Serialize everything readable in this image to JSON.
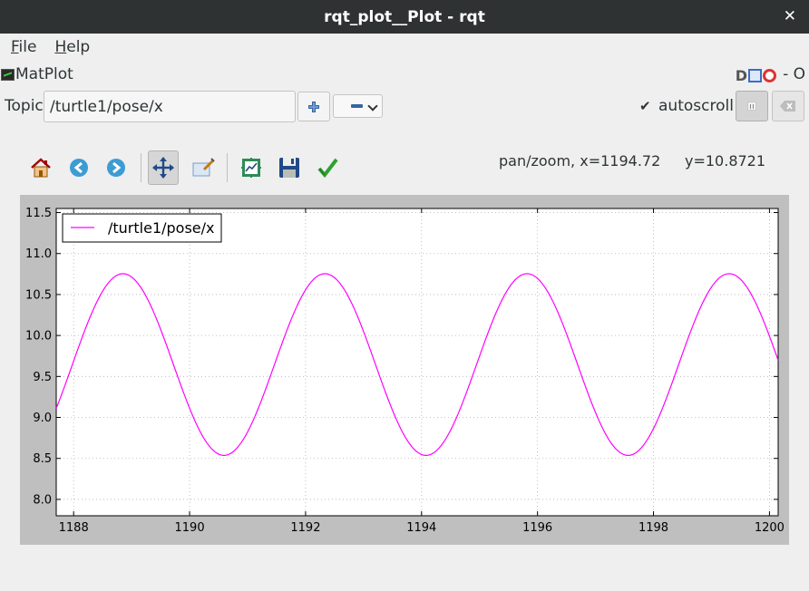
{
  "window": {
    "title": "rqt_plot__Plot - rqt",
    "close_glyph": "✕"
  },
  "menu": [
    {
      "mnemonic": "F",
      "rest": "ile"
    },
    {
      "mnemonic": "H",
      "rest": "elp"
    }
  ],
  "plugin": {
    "title": "MatPlot",
    "dock_label": "D",
    "suffix": "- O"
  },
  "topic": {
    "label": "Topic",
    "value": "/turtle1/pose/x",
    "add_icon": "plus-icon",
    "remove_icon": "minus-icon"
  },
  "autoscroll": {
    "label": "autoscroll",
    "checked": true
  },
  "toolbar": {
    "tools": [
      "home-icon",
      "back-icon",
      "forward-icon",
      "pan-zoom-icon",
      "configure-subplots-icon",
      "edit-axis-icon",
      "save-icon",
      "apply-icon"
    ],
    "active_tool": "pan-zoom-icon",
    "status": "pan/zoom, x=1194.72",
    "status_y": "y=10.8721"
  },
  "colors": {
    "line": "#ff00ff",
    "titlebar": "#2f3233",
    "plot_bg": "#ffffff",
    "frame": "#bfbfbf"
  },
  "chart_data": {
    "type": "line",
    "series": [
      {
        "name": "/turtle1/pose/x",
        "color": "#ff00ff"
      }
    ],
    "xlim": [
      1187.7,
      1200.15
    ],
    "ylim": [
      7.8,
      11.55
    ],
    "xticks": [
      "1188",
      "1190",
      "1192",
      "1194",
      "1196",
      "1198",
      "1200"
    ],
    "yticks": [
      "8.0",
      "8.5",
      "9.0",
      "9.5",
      "10.0",
      "10.5",
      "11.0",
      "11.5"
    ],
    "ytick_values": [
      8.0,
      8.5,
      9.0,
      9.5,
      10.0,
      10.5,
      11.0,
      11.5
    ],
    "xtick_values": [
      1188,
      1190,
      1192,
      1194,
      1196,
      1198,
      1200
    ],
    "signal": {
      "offset": 9.6455,
      "amplitude": 1.1085,
      "period": 3.485,
      "peak_x": 1188.85
    },
    "grid": true,
    "legend": "top-left"
  }
}
